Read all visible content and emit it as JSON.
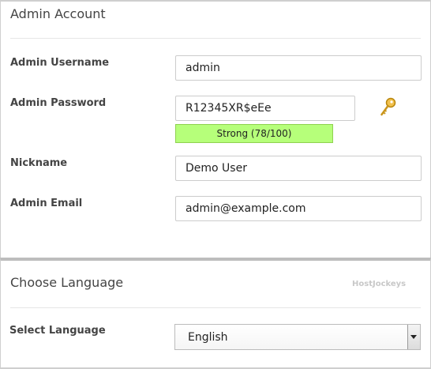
{
  "admin_account": {
    "title": "Admin Account",
    "username": {
      "label": "Admin Username",
      "value": "admin"
    },
    "password": {
      "label": "Admin Password",
      "value": "R12345XR$eEe",
      "strength_text": "Strong (78/100)",
      "strength_color": "#b6ff7a",
      "generate_icon": "key-icon"
    },
    "nickname": {
      "label": "Nickname",
      "value": "Demo User"
    },
    "email": {
      "label": "Admin Email",
      "value": "admin@example.com"
    }
  },
  "language": {
    "title": "Choose Language",
    "watermark": "HostJockeys",
    "select_label": "Select Language",
    "selected": "English"
  }
}
